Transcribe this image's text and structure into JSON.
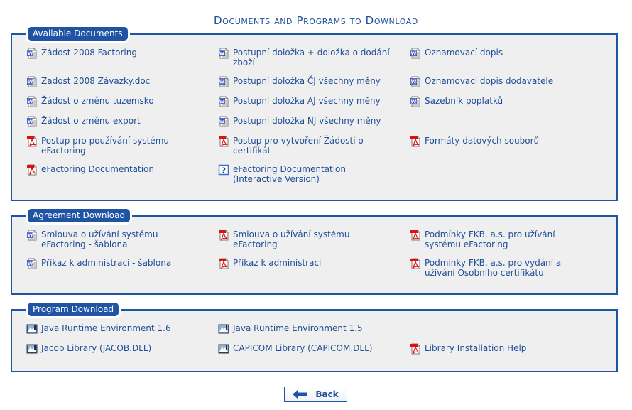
{
  "page": {
    "title": "Documents and Programs to Download"
  },
  "sections": [
    {
      "title": "Available Documents",
      "items": [
        {
          "label": "Žádost 2008 Factoring",
          "icon": "word-doc-icon"
        },
        {
          "label": "Postupní doložka + doložka o dodání zboží",
          "icon": "word-doc-icon"
        },
        {
          "label": "Oznamovací dopis",
          "icon": "word-doc-icon"
        },
        {
          "label": "Zadost 2008 Závazky.doc",
          "icon": "word-doc-icon"
        },
        {
          "label": "Postupní doložka ČJ všechny měny",
          "icon": "word-doc-icon"
        },
        {
          "label": "Oznamovací dopis dodavatele",
          "icon": "word-doc-icon"
        },
        {
          "label": "Žádost o změnu tuzemsko",
          "icon": "word-doc-icon"
        },
        {
          "label": "Postupní doložka AJ všechny měny",
          "icon": "word-doc-icon"
        },
        {
          "label": "Sazebník poplatků",
          "icon": "word-doc-icon"
        },
        {
          "label": "Žádost o změnu export",
          "icon": "word-doc-icon"
        },
        {
          "label": "Postupní doložka NJ všechny měny",
          "icon": "word-doc-icon"
        },
        {
          "label": "Postup pro používání systému eFactoring",
          "icon": "pdf-icon"
        },
        {
          "label": "Postup pro vytvoření Žádosti o certifikát",
          "icon": "pdf-icon"
        },
        {
          "label": "Formáty datových souborů",
          "icon": "pdf-icon"
        },
        {
          "label": "eFactoring Documentation",
          "icon": "pdf-icon"
        },
        {
          "label": "eFactoring Documentation (Interactive Version)",
          "icon": "help-icon"
        }
      ]
    },
    {
      "title": "Agreement Download",
      "items": [
        {
          "label": "Smlouva o užívání systému eFactoring - šablona",
          "icon": "word-doc-icon"
        },
        {
          "label": "Smlouva o užívání systému eFactoring",
          "icon": "pdf-icon"
        },
        {
          "label": "Podmínky FKB, a.s. pro užívání systému eFactoring",
          "icon": "pdf-icon"
        },
        {
          "label": "Příkaz k administraci - šablona",
          "icon": "word-doc-icon"
        },
        {
          "label": "Příkaz k administraci",
          "icon": "pdf-icon"
        },
        {
          "label": "Podmínky FKB, a.s. pro vydání a užívání Osobního certifikátu",
          "icon": "pdf-icon"
        }
      ]
    },
    {
      "title": "Program Download",
      "items": [
        {
          "label": "Java Runtime Environment 1.6",
          "icon": "installer-icon"
        },
        {
          "label": "Java Runtime Environment 1.5",
          "icon": "installer-icon"
        },
        {
          "label": "Jacob Library (JACOB.DLL)",
          "icon": "installer-icon"
        },
        {
          "label": "CAPICOM Library (CAPICOM.DLL)",
          "icon": "installer-icon"
        },
        {
          "label": "Library Installation Help",
          "icon": "pdf-icon"
        }
      ]
    }
  ],
  "buttons": {
    "back_label": "Back"
  },
  "colors": {
    "accent": "#1f54a5",
    "panel_bg": "#efefef",
    "link": "#1f4f99"
  }
}
